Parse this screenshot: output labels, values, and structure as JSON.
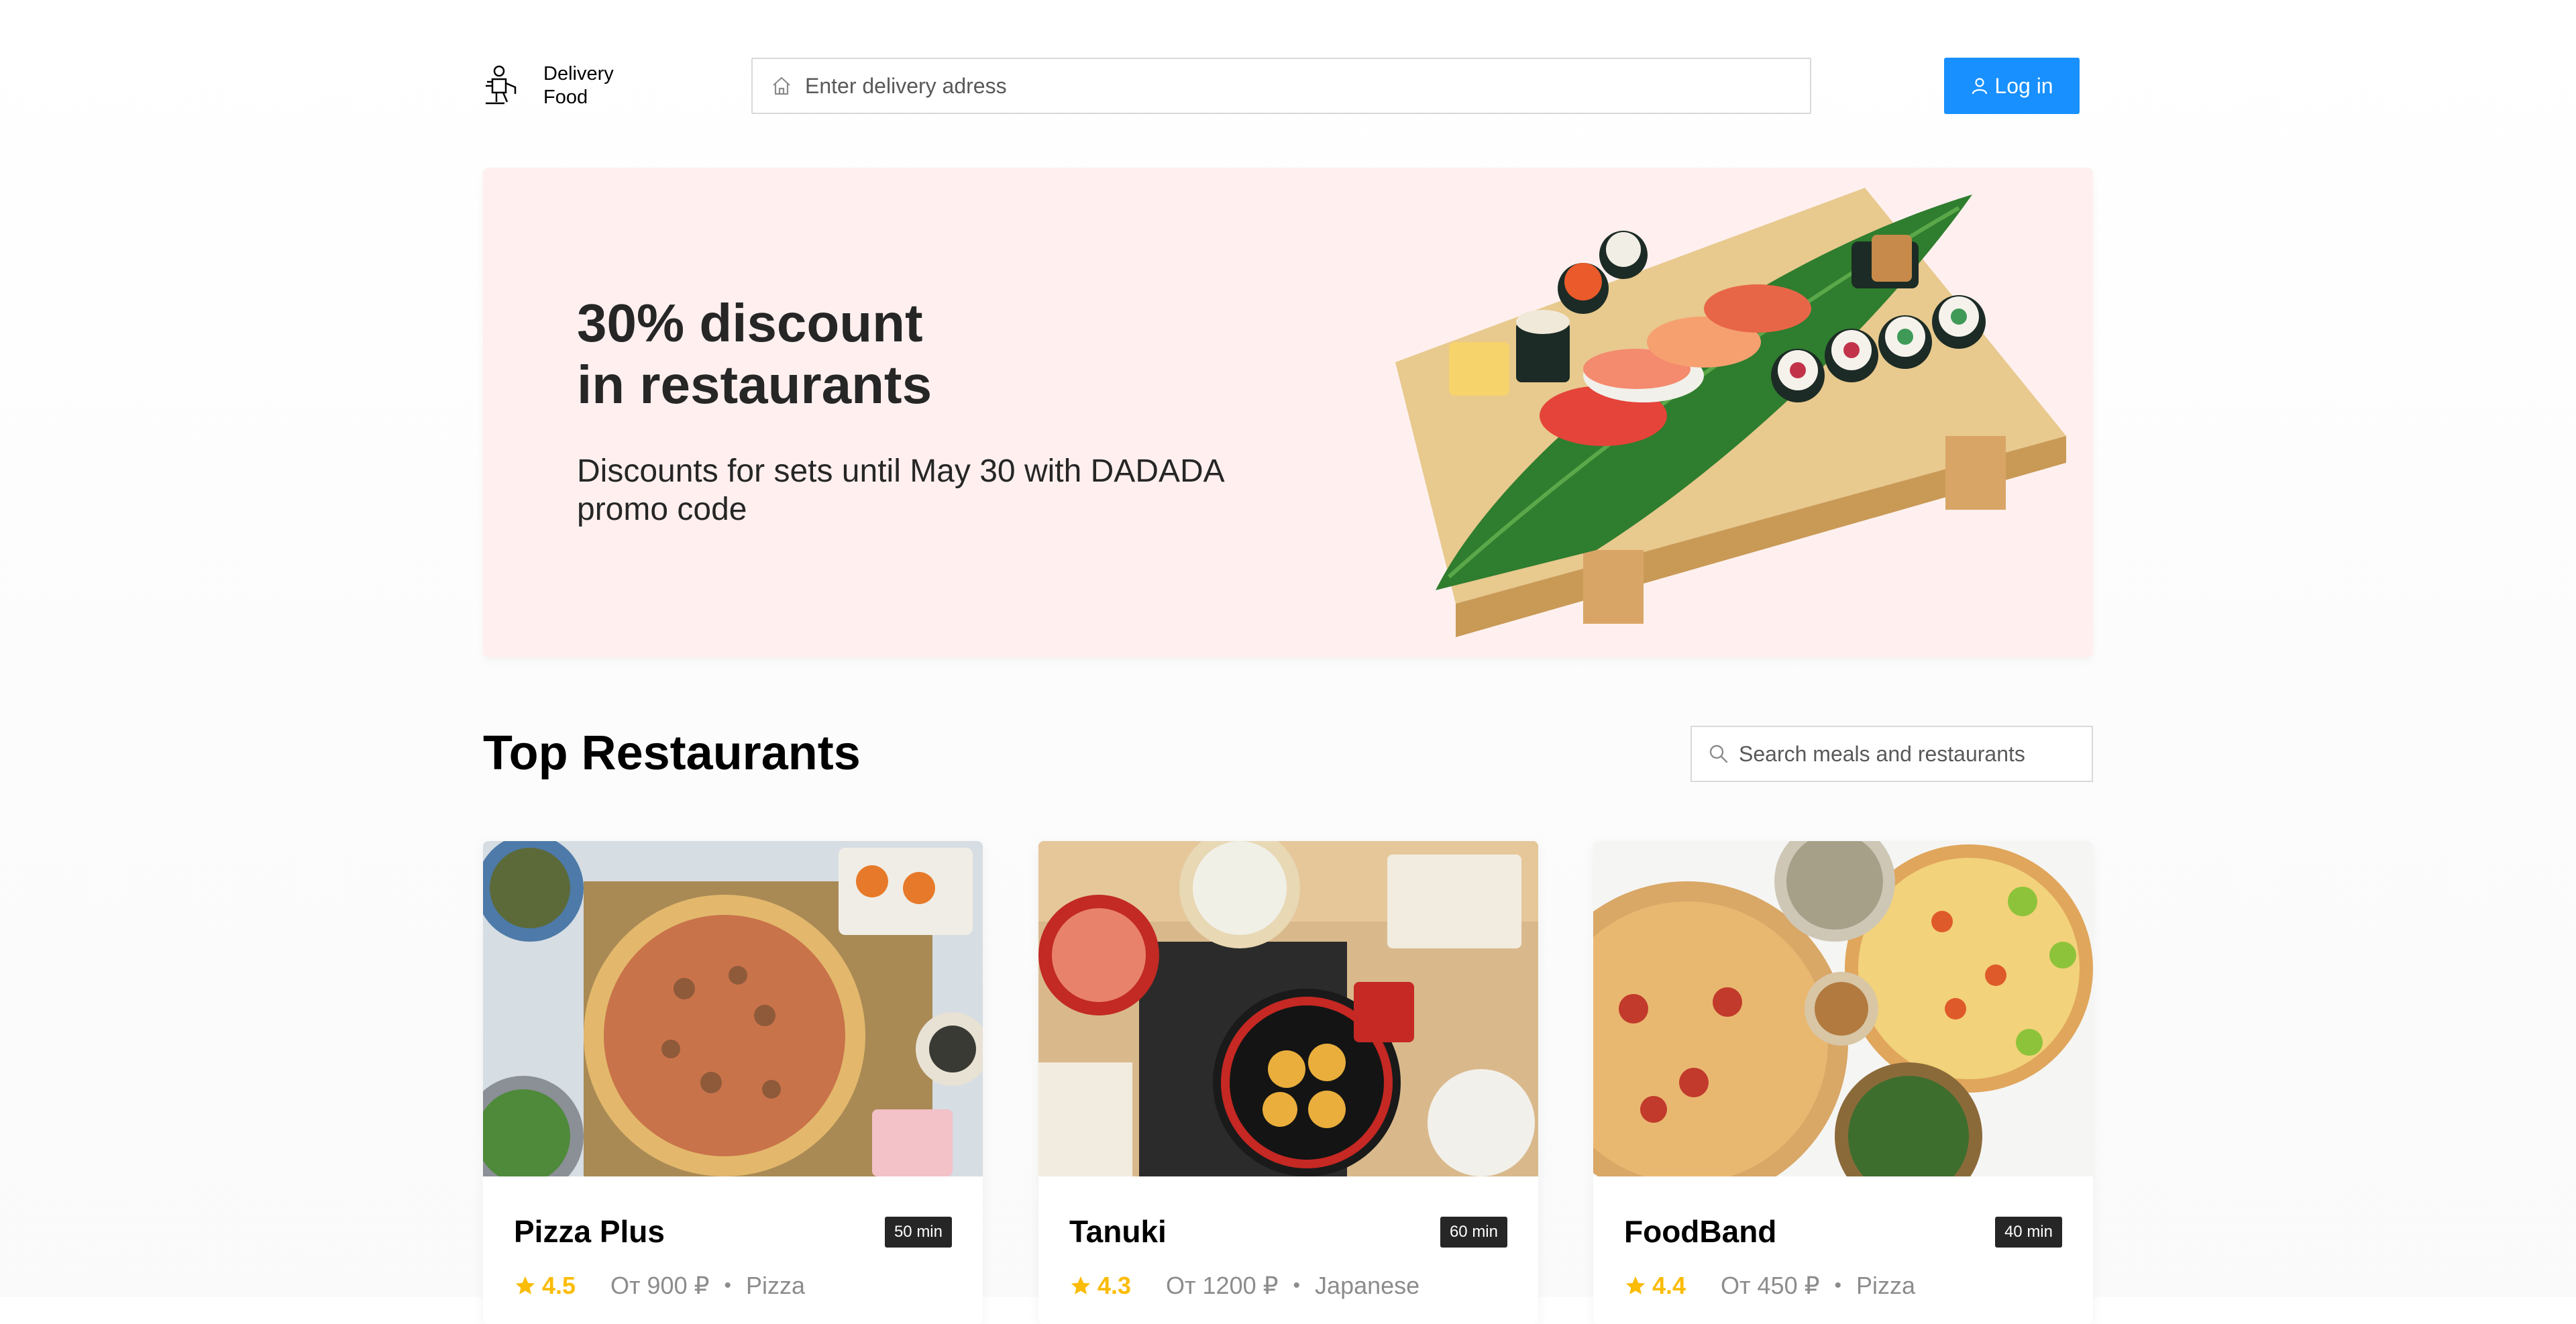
{
  "header": {
    "logo_line1": "Delivery",
    "logo_line2": "Food",
    "address_placeholder": "Enter delivery adress",
    "login_label": "Log in"
  },
  "promo": {
    "title": "30% discount\nin restaurants",
    "text": "Discounts for sets until May 30 with DADADA promo code"
  },
  "section": {
    "title": "Top Restaurants",
    "search_placeholder": "Search meals and restaurants"
  },
  "restaurants": [
    {
      "name": "Pizza Plus",
      "time": "50 min",
      "rating": "4.5",
      "price": "От 900 ₽",
      "category": "Pizza"
    },
    {
      "name": "Tanuki",
      "time": "60 min",
      "rating": "4.3",
      "price": "От 1200 ₽",
      "category": "Japanese"
    },
    {
      "name": "FoodBand",
      "time": "40 min",
      "rating": "4.4",
      "price": "От 450 ₽",
      "category": "Pizza"
    }
  ],
  "colors": {
    "accent": "#1890ff",
    "promo_bg": "#fff0ef",
    "rating": "#fbbc06"
  }
}
